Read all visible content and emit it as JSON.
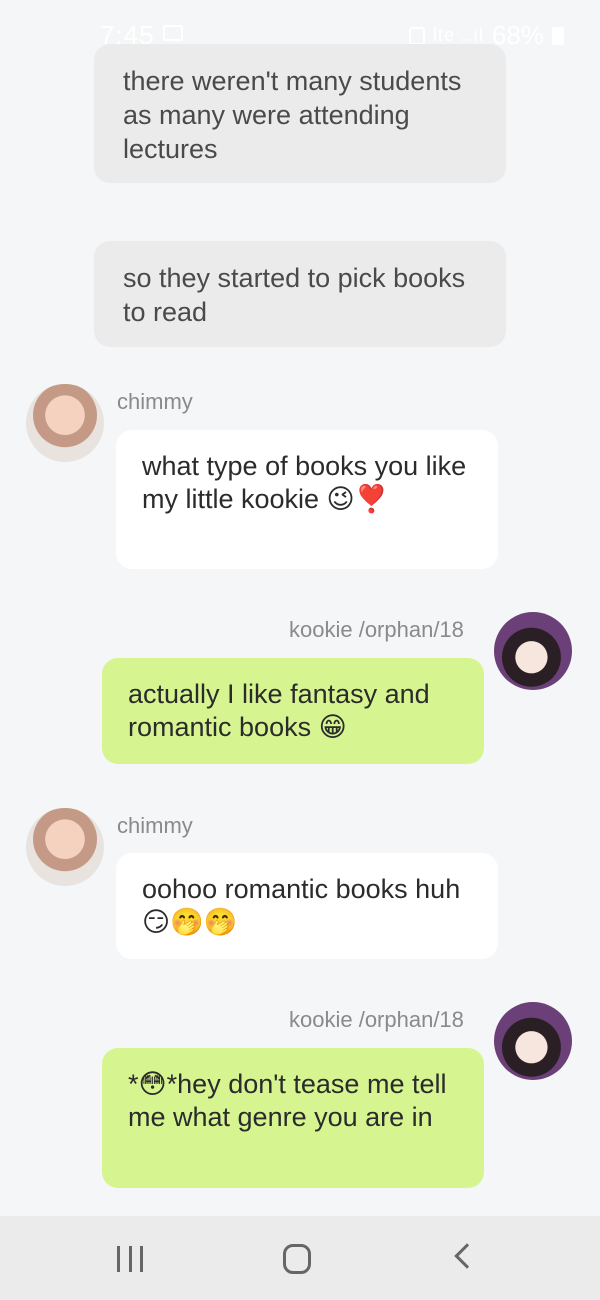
{
  "status_bar": {
    "time": "7:45",
    "signal": "lte ..ıl",
    "battery": "68%"
  },
  "narrations": [
    "there weren't many students as many were attending lectures",
    "so they started to pick books to read"
  ],
  "messages": [
    {
      "sender": "chimmy",
      "side": "received",
      "text": "what type of books you like my little kookie 😉❣️"
    },
    {
      "sender": "kookie /orphan/18",
      "side": "sent",
      "text": "actually I like fantasy and romantic books 😁"
    },
    {
      "sender": "chimmy",
      "side": "received",
      "text": "oohoo romantic books huh 😏🤭🤭"
    },
    {
      "sender": "kookie /orphan/18",
      "side": "sent",
      "text": "*😳*hey don't tease me tell me what genre you are in"
    }
  ],
  "colors": {
    "background": "#f5f6f8",
    "narration_bubble": "#ebebec",
    "received_bubble": "#ffffff",
    "sent_bubble": "#d6f591",
    "sender_name": "#8a8a8a"
  },
  "nav_bar": {
    "icons": [
      "recents-icon",
      "home-icon",
      "back-icon"
    ]
  }
}
